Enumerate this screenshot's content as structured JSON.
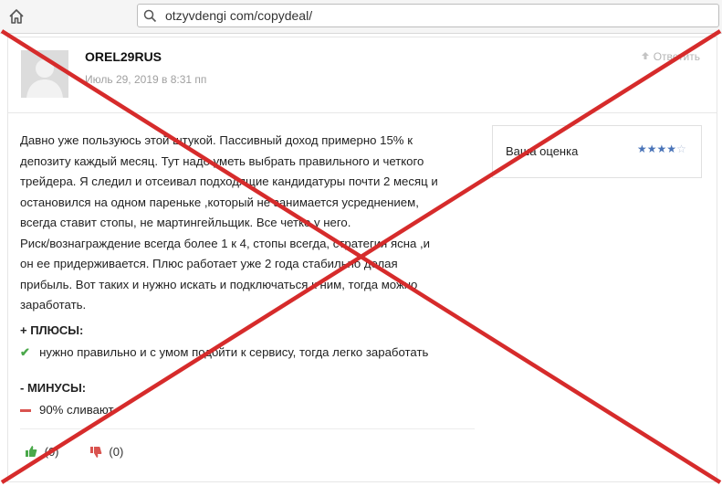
{
  "browser": {
    "url": "otzyvdengi com/copydeal/"
  },
  "comment": {
    "author": "OREL29RUS",
    "date": "Июль 29, 2019 в 8:31 пп",
    "reply_label": "Ответить",
    "text_lines": [
      "Давно уже пользуюсь этой штукой. Пассивный доход примерно 15% к",
      "депозиту каждый месяц. Тут надо уметь выбрать правильного и четкого",
      "трейдера. Я следил и отсеивал подходящие кандидатуры почти 2 месяц и",
      "остановился на одном пареньке ,который не занимается усреднением,",
      "всегда ставит стопы, не мартингейльщик. Все четко у него.",
      "Риск/вознаграждение всегда более 1 к 4, стопы всегда, стратегия ясна ,и",
      "он ее придерживается. Плюс работает уже 2 года стабильно делая",
      "прибыль. Вот таких и нужно искать и подключаться к ним, тогда можно",
      "заработать."
    ],
    "pros_title": "+ ПЛЮСЫ:",
    "pros_item": "нужно правильно и с умом подойти к сервису, тогда легко заработать",
    "cons_title": "- МИНУСЫ:",
    "cons_item": "90% сливают",
    "likes": "(0)",
    "dislikes": "(0)"
  },
  "rating": {
    "label": "Ваша оценка",
    "stars_filled": 4,
    "stars_total": 5
  },
  "colors": {
    "cross": "#d62b2b",
    "star": "#4a74b8",
    "check": "#4aa84a",
    "minus": "#d9534f"
  },
  "icons": [
    "home-icon",
    "search-icon",
    "reply-arrow-icon",
    "check-icon",
    "minus-icon",
    "thumbs-up-icon",
    "thumbs-down-icon",
    "star-icon"
  ]
}
